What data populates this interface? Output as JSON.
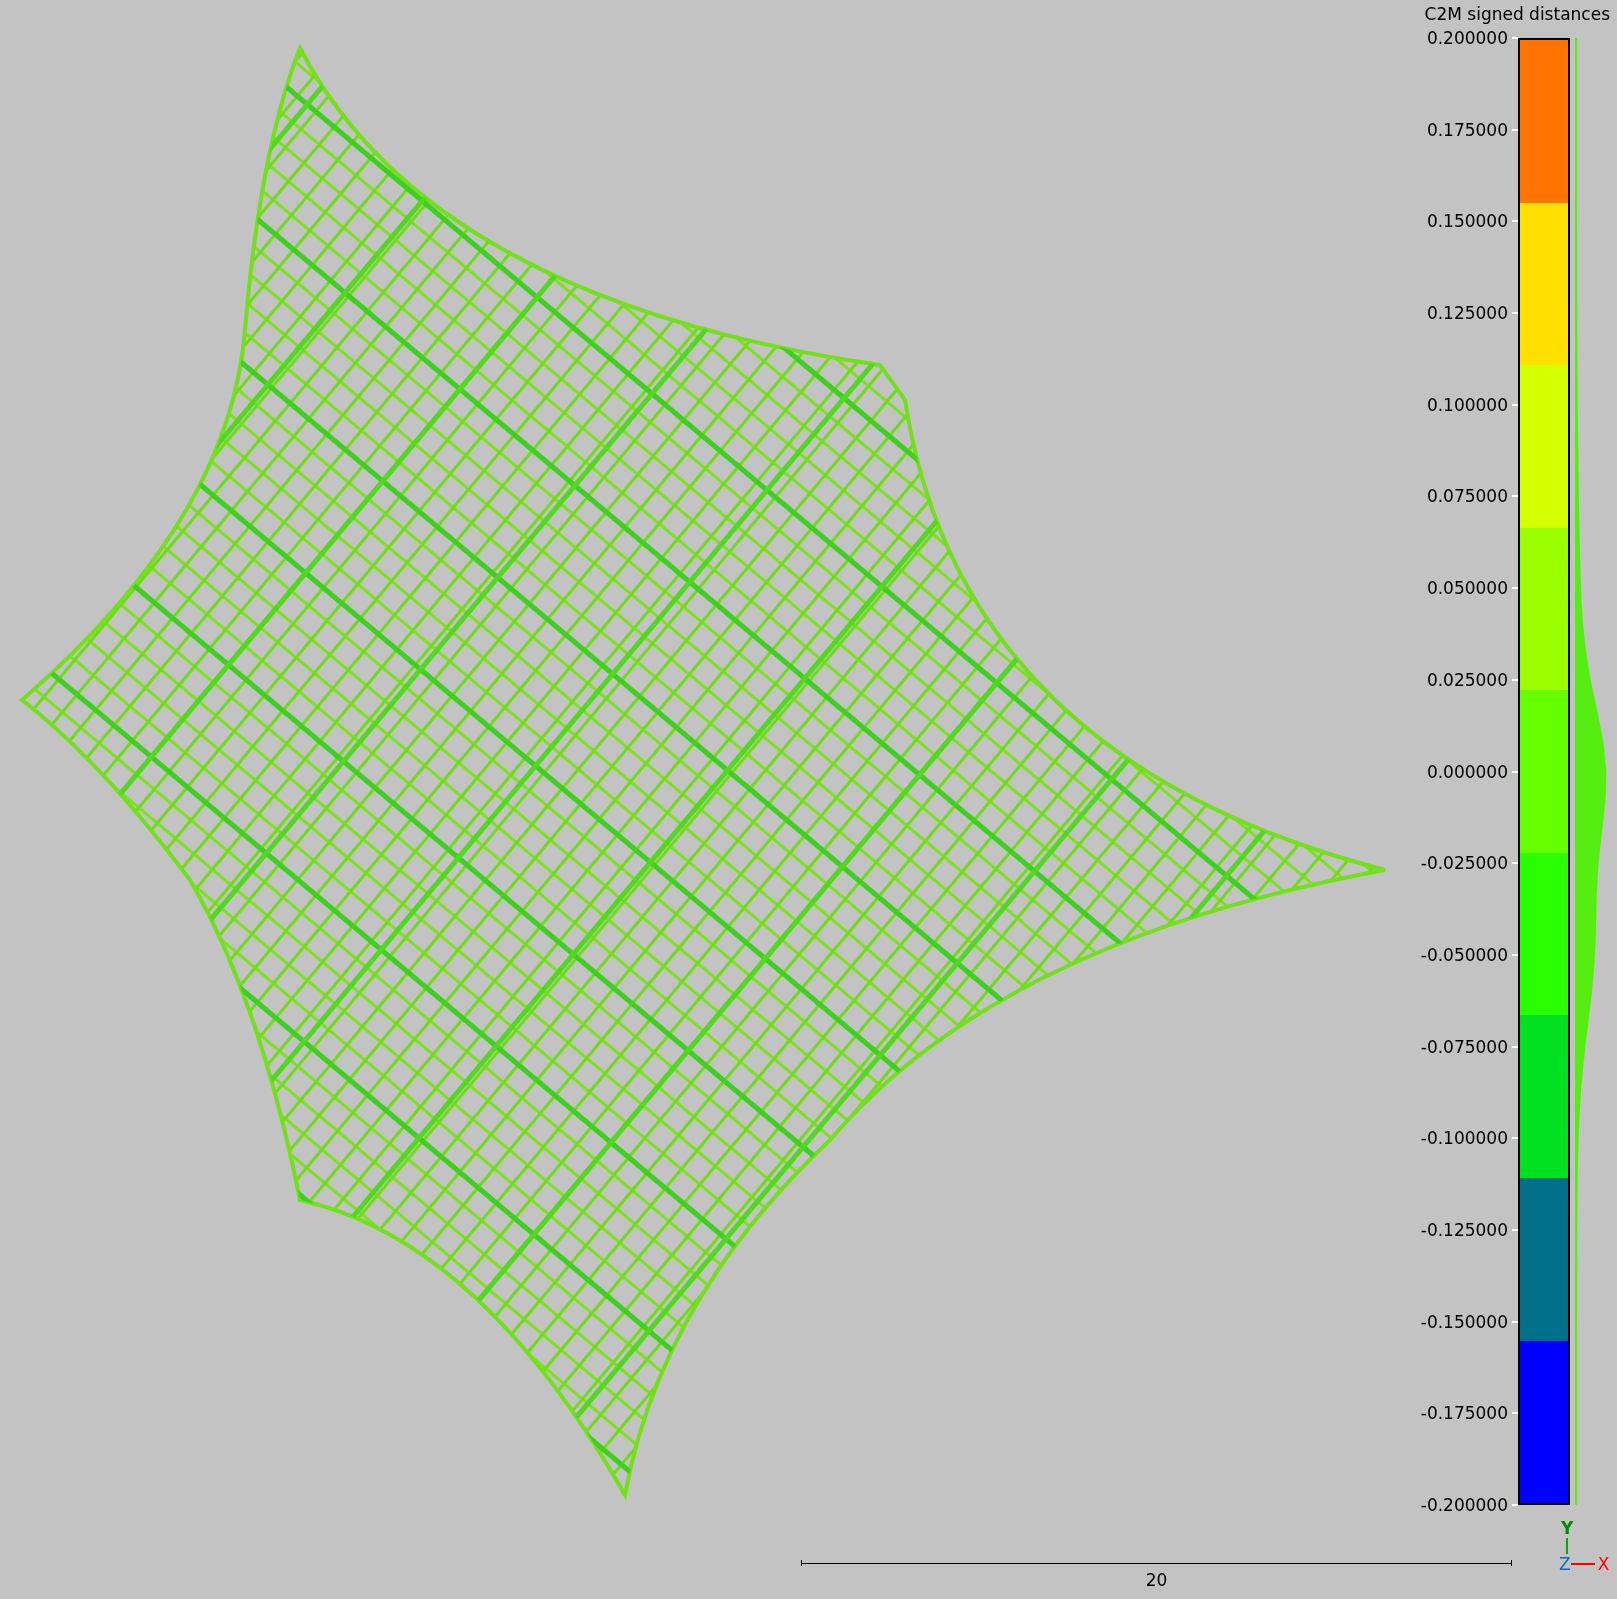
{
  "legend": {
    "title": "C2M signed distances",
    "labels": [
      "0.200000",
      "0.175000",
      "0.150000",
      "0.125000",
      "0.100000",
      "0.075000",
      "0.050000",
      "0.025000",
      "0.000000",
      "-0.025000",
      "-0.050000",
      "-0.075000",
      "-0.100000",
      "-0.125000",
      "-0.150000",
      "-0.175000",
      "-0.200000"
    ],
    "bands": [
      {
        "color": "#ff7300"
      },
      {
        "color": "#ffe000"
      },
      {
        "color": "#d4ff00"
      },
      {
        "color": "#9bff00"
      },
      {
        "color": "#66ff00"
      },
      {
        "color": "#2aff00"
      },
      {
        "color": "#00e01e"
      },
      {
        "color": "#00708a"
      },
      {
        "color": "#0000ff"
      }
    ]
  },
  "scale_bar": {
    "label": "20"
  },
  "axes": {
    "y": "Y",
    "z": "Z",
    "x": "X"
  }
}
